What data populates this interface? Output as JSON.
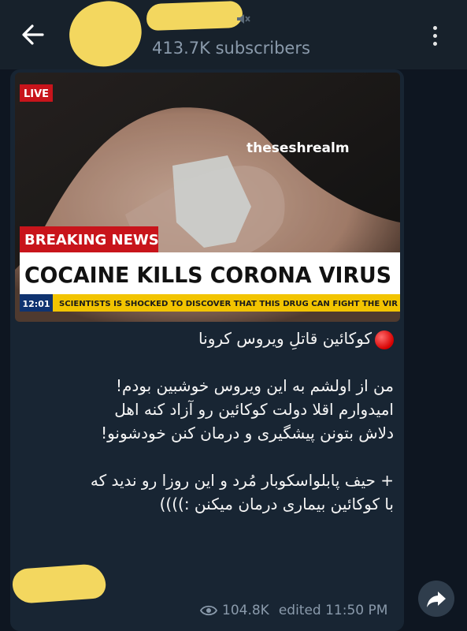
{
  "header": {
    "back_icon": "arrow-left-icon",
    "subscribers": "413.7K subscribers",
    "menu_icon": "more-vertical-icon"
  },
  "post": {
    "image": {
      "live_badge": "LIVE",
      "watermark": "theseshrealm",
      "breaking_label": "BREAKING NEWS",
      "headline": "COCAINE KILLS CORONA VIRUS",
      "time": "12:01",
      "ticker": "SCIENTISTS IS SHOCKED TO DISCOVER THAT THIS DRUG CAN FIGHT THE VIR"
    },
    "caption_title": "کوکائین قاتلِ ویروس کرونا",
    "caption_lines": [
      "من از اولشم به این ویروس خوشبین بودم!",
      "امیدوارم اقلا دولت کوکائین رو آزاد کنه اهل",
      "دلاش بتونن پیشگیری و درمان کنن خودشونو!",
      "",
      "+ حیف پابلواسکوبار مُرد و این روزا رو ندید که",
      "با کوکائین بیماری درمان میکنن :))))"
    ],
    "views": "104.8K",
    "edited_time": "edited 11:50 PM",
    "share_icon": "share-icon"
  },
  "colors": {
    "background": "#0e1621",
    "header": "#17212b",
    "bubble": "#182533",
    "meta_text": "#8a9aab",
    "redaction": "#f3d75f",
    "breaking_red": "#c8141b",
    "ticker_yellow": "#f2c400"
  }
}
